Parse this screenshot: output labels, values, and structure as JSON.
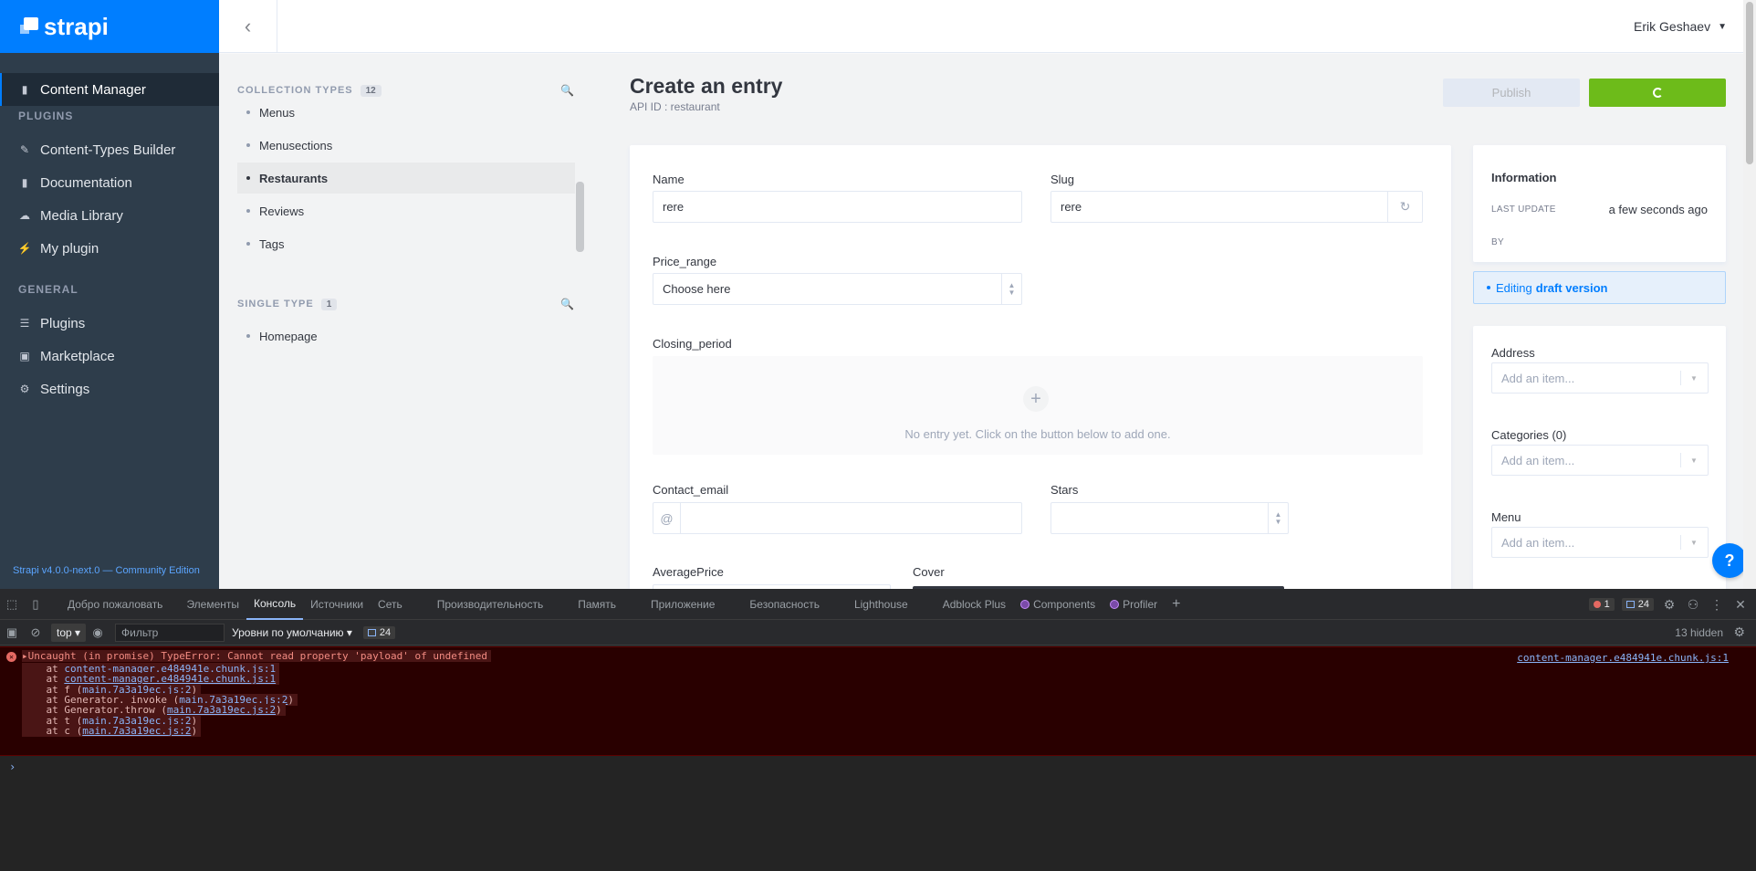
{
  "sidebar": {
    "brand": "strapi",
    "items_top": [
      {
        "label": "Content Manager",
        "icon": "book-icon"
      }
    ],
    "plugins_title": "PLUGINS",
    "plugins": [
      {
        "label": "Content-Types Builder",
        "icon": "brush-icon"
      },
      {
        "label": "Documentation",
        "icon": "book-icon"
      },
      {
        "label": "Media Library",
        "icon": "cloud-icon"
      },
      {
        "label": "My plugin",
        "icon": "plug-icon"
      }
    ],
    "general_title": "GENERAL",
    "general": [
      {
        "label": "Plugins",
        "icon": "list-icon"
      },
      {
        "label": "Marketplace",
        "icon": "basket-icon"
      },
      {
        "label": "Settings",
        "icon": "gear-icon"
      }
    ],
    "footer": "Strapi v4.0.0-next.0 — Community Edition"
  },
  "topbar": {
    "user": "Erik Geshaev"
  },
  "subnav": {
    "collection_title": "COLLECTION TYPES",
    "collection_count": "12",
    "collection_items": [
      "Menus",
      "Menusections",
      "Restaurants",
      "Reviews",
      "Tags"
    ],
    "single_title": "SINGLE TYPE",
    "single_count": "1",
    "single_items": [
      "Homepage"
    ]
  },
  "main": {
    "title": "Create an entry",
    "subtitle": "API ID : restaurant",
    "publish_label": "Publish",
    "fields": {
      "name_label": "Name",
      "name_value": "rere",
      "slug_label": "Slug",
      "slug_value": "rere",
      "price_label": "Price_range",
      "price_value": "Choose here",
      "closing_label": "Closing_period",
      "closing_empty": "No entry yet. Click on the button below to add one.",
      "email_label": "Contact_email",
      "stars_label": "Stars",
      "avg_label": "AveragePrice",
      "cover_label": "Cover"
    },
    "info": {
      "title": "Information",
      "last_update_key": "LAST UPDATE",
      "last_update_val": "a few seconds ago",
      "by_key": "BY",
      "draft_prefix": "Editing",
      "draft_bold": "draft version"
    },
    "relations": [
      {
        "label": "Address",
        "placeholder": "Add an item..."
      },
      {
        "label": "Categories (0)",
        "placeholder": "Add an item..."
      },
      {
        "label": "Menu",
        "placeholder": "Add an item..."
      }
    ],
    "help": "?"
  },
  "devtools": {
    "tabs": [
      "Добро пожаловать",
      "Элементы",
      "Консоль",
      "Источники",
      "Сеть",
      "Производительность",
      "Память",
      "Приложение",
      "Безопасность",
      "Lighthouse",
      "Adblock Plus",
      "Components",
      "Profiler"
    ],
    "active_tab": "Консоль",
    "error_count": "1",
    "message_count": "24",
    "context": "top",
    "filter_placeholder": "Фильтр",
    "levels": "Уровни по умолчанию",
    "hidden": "13 hidden",
    "error": {
      "head": "Uncaught (in promise) TypeError: Cannot read property 'payload' of undefined",
      "source": "content-manager.e484941e.chunk.js:1",
      "frames": [
        {
          "prefix": "    at ",
          "link": "content-manager.e484941e.chunk.js:1",
          "suffix": ""
        },
        {
          "prefix": "    at ",
          "link": "content-manager.e484941e.chunk.js:1",
          "suffix": ""
        },
        {
          "prefix": "    at f (",
          "link": "main.7a3a19ec.js:2",
          "suffix": ")"
        },
        {
          "prefix": "    at Generator._invoke (",
          "link": "main.7a3a19ec.js:2",
          "suffix": ")"
        },
        {
          "prefix": "    at Generator.throw (",
          "link": "main.7a3a19ec.js:2",
          "suffix": ")"
        },
        {
          "prefix": "    at t (",
          "link": "main.7a3a19ec.js:2",
          "suffix": ")"
        },
        {
          "prefix": "    at c (",
          "link": "main.7a3a19ec.js:2",
          "suffix": ")"
        }
      ]
    },
    "prompt": "›"
  }
}
